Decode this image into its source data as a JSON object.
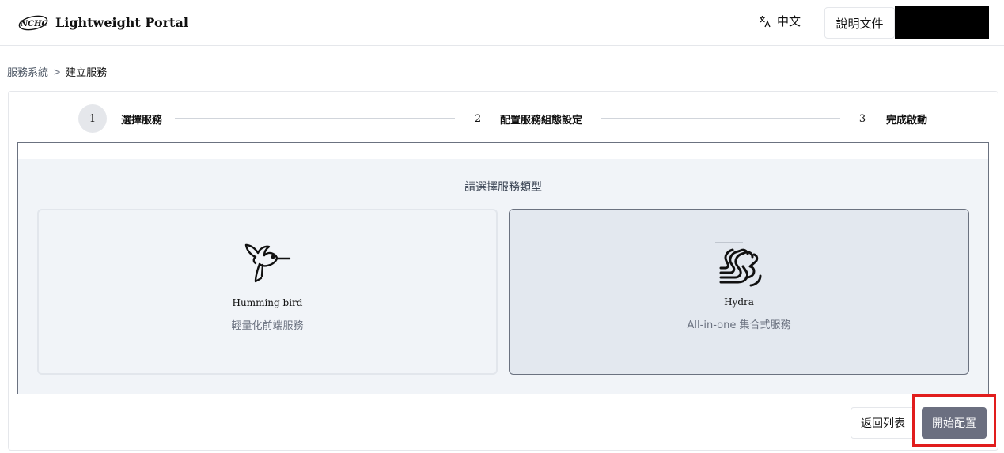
{
  "header": {
    "logo_text": "NCHC",
    "app_title": "Lightweight Portal",
    "language_label": "中文",
    "docs_label": "說明文件"
  },
  "breadcrumb": {
    "parent": "服務系統",
    "separator": ">",
    "current": "建立服務"
  },
  "stepper": {
    "steps": [
      {
        "number": "1",
        "label": "選擇服務",
        "active": true
      },
      {
        "number": "2",
        "label": "配置服務組態設定",
        "active": false
      },
      {
        "number": "3",
        "label": "完成啟動",
        "active": false
      }
    ]
  },
  "selector": {
    "title": "請選擇服務類型",
    "options": [
      {
        "name": "Humming bird",
        "description": "輕量化前端服務",
        "icon": "hummingbird-icon",
        "selected": false
      },
      {
        "name": "Hydra",
        "description": "All-in-one 集合式服務",
        "icon": "hydra-icon",
        "selected": true
      }
    ]
  },
  "footer": {
    "back_label": "返回列表",
    "start_label": "開始配置"
  },
  "colors": {
    "primary_button": "#6b6f80",
    "highlight": "#e11d1d",
    "panel_bg": "#f1f4f8"
  }
}
